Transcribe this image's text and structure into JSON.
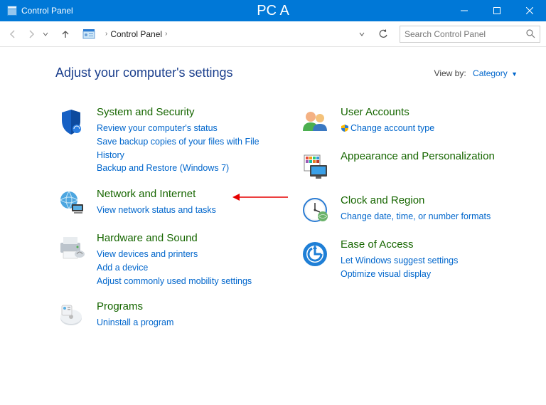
{
  "titlebar": {
    "app_title": "Control Panel",
    "pc_title": "PC A"
  },
  "breadcrumb": {
    "label": "Control Panel"
  },
  "search": {
    "placeholder": "Search Control Panel"
  },
  "header": {
    "title": "Adjust your computer's settings",
    "viewby_label": "View by:",
    "viewby_value": "Category"
  },
  "left": {
    "system": {
      "title": "System and Security",
      "l1": "Review your computer's status",
      "l2": "Save backup copies of your files with File History",
      "l3": "Backup and Restore (Windows 7)"
    },
    "network": {
      "title": "Network and Internet",
      "l1": "View network status and tasks"
    },
    "hardware": {
      "title": "Hardware and Sound",
      "l1": "View devices and printers",
      "l2": "Add a device",
      "l3": "Adjust commonly used mobility settings"
    },
    "programs": {
      "title": "Programs",
      "l1": "Uninstall a program"
    }
  },
  "right": {
    "users": {
      "title": "User Accounts",
      "l1": "Change account type"
    },
    "appearance": {
      "title": "Appearance and Personalization"
    },
    "clock": {
      "title": "Clock and Region",
      "l1": "Change date, time, or number formats"
    },
    "ease": {
      "title": "Ease of Access",
      "l1": "Let Windows suggest settings",
      "l2": "Optimize visual display"
    }
  }
}
